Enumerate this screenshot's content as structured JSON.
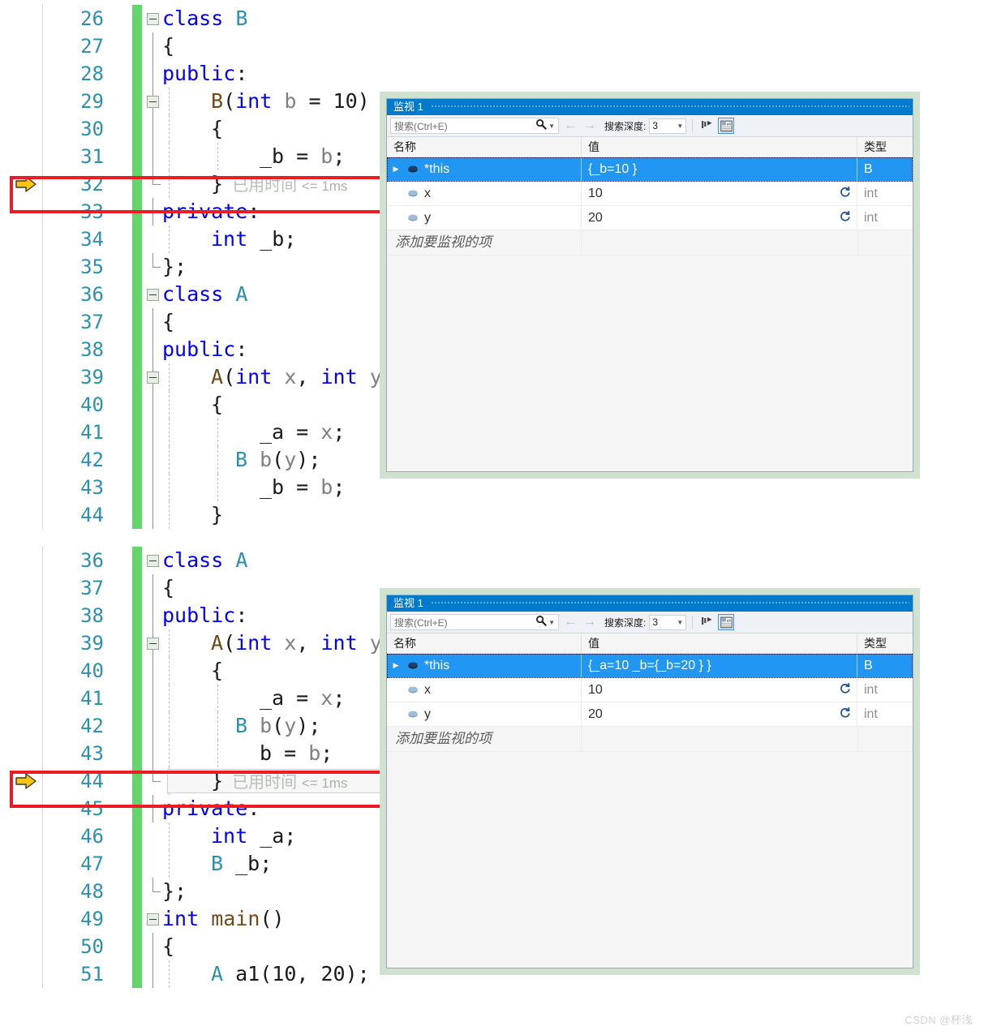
{
  "colors": {
    "accent_blue": "#007acc",
    "selection_blue": "#2196f3",
    "annotation_red": "#ed1c24",
    "change_bar_green": "#63d66b",
    "linenumber_teal": "#2b91af",
    "keyword_blue": "#0000ff",
    "type_teal": "#2b91af",
    "function_brown": "#6f4a18",
    "elapsed_gray": "#b6bfb6"
  },
  "editors": [
    {
      "name": "editor-top",
      "current_line": 32,
      "lines": [
        {
          "no": "26",
          "fold": "minus",
          "guide": "none",
          "tokens": [
            {
              "t": "class ",
              "c": "kw"
            },
            {
              "t": "B",
              "c": "typ"
            }
          ],
          "indent": 0
        },
        {
          "no": "27",
          "fold": null,
          "guide": "solid",
          "tokens": [
            {
              "t": "{",
              "c": "pun"
            }
          ],
          "indent": 0
        },
        {
          "no": "28",
          "fold": null,
          "guide": "solid",
          "tokens": [
            {
              "t": "public",
              "c": "kw"
            },
            {
              "t": ":",
              "c": "pun"
            }
          ],
          "indent": 0
        },
        {
          "no": "29",
          "fold": "minus",
          "guide": "solid-dash",
          "tokens": [
            {
              "t": "B",
              "c": "fn"
            },
            {
              "t": "(",
              "c": "pun"
            },
            {
              "t": "int",
              "c": "kw"
            },
            {
              "t": " b",
              "c": "var"
            },
            {
              "t": " = ",
              "c": "pun"
            },
            {
              "t": "10",
              "c": "num"
            },
            {
              "t": ")",
              "c": "pun"
            }
          ],
          "indent": 2
        },
        {
          "no": "30",
          "fold": null,
          "guide": "solid-dash",
          "tokens": [
            {
              "t": "{",
              "c": "pun"
            }
          ],
          "indent": 2
        },
        {
          "no": "31",
          "fold": null,
          "guide": "solid-dash2",
          "tokens": [
            {
              "t": "_b",
              "c": "idn"
            },
            {
              "t": " = ",
              "c": "pun"
            },
            {
              "t": "b",
              "c": "var"
            },
            {
              "t": ";",
              "c": "pun"
            }
          ],
          "indent": 4
        },
        {
          "no": "32",
          "fold": null,
          "guide": "solid-endcap-dash",
          "arrow": true,
          "tokens": [
            {
              "t": "}",
              "c": "pun"
            }
          ],
          "indent": 2,
          "elapsed": "已用时间",
          "elapsed_ms": "<= 1ms"
        },
        {
          "no": "33",
          "fold": null,
          "guide": "solid",
          "tokens": [
            {
              "t": "private",
              "c": "kw"
            },
            {
              "t": ":",
              "c": "pun"
            }
          ],
          "indent": 0
        },
        {
          "no": "34",
          "fold": null,
          "guide": "dash",
          "tokens": [
            {
              "t": "int",
              "c": "kw"
            },
            {
              "t": " _b;",
              "c": "idn"
            }
          ],
          "indent": 2
        },
        {
          "no": "35",
          "fold": null,
          "guide": "endcap",
          "tokens": [
            {
              "t": "};",
              "c": "pun"
            }
          ],
          "indent": 0
        },
        {
          "no": "36",
          "fold": "minus",
          "guide": "none",
          "tokens": [
            {
              "t": "class ",
              "c": "kw"
            },
            {
              "t": "A",
              "c": "typ"
            }
          ],
          "indent": 0
        },
        {
          "no": "37",
          "fold": null,
          "guide": "solid",
          "tokens": [
            {
              "t": "{",
              "c": "pun"
            }
          ],
          "indent": 0
        },
        {
          "no": "38",
          "fold": null,
          "guide": "solid",
          "tokens": [
            {
              "t": "public",
              "c": "kw"
            },
            {
              "t": ":",
              "c": "pun"
            }
          ],
          "indent": 0
        },
        {
          "no": "39",
          "fold": "minus",
          "guide": "solid-dash",
          "tokens": [
            {
              "t": "A",
              "c": "fn"
            },
            {
              "t": "(",
              "c": "pun"
            },
            {
              "t": "int",
              "c": "kw"
            },
            {
              "t": " x",
              "c": "var"
            },
            {
              "t": ", ",
              "c": "pun"
            },
            {
              "t": "int",
              "c": "kw"
            },
            {
              "t": " y",
              "c": "var"
            },
            {
              "t": ")",
              "c": "pun"
            }
          ],
          "indent": 2
        },
        {
          "no": "40",
          "fold": null,
          "guide": "solid-dash",
          "tokens": [
            {
              "t": "{",
              "c": "pun"
            }
          ],
          "indent": 2
        },
        {
          "no": "41",
          "fold": null,
          "guide": "solid-dash2",
          "tokens": [
            {
              "t": "_a",
              "c": "idn"
            },
            {
              "t": " = ",
              "c": "pun"
            },
            {
              "t": "x",
              "c": "var"
            },
            {
              "t": ";",
              "c": "pun"
            }
          ],
          "indent": 4
        },
        {
          "no": "42",
          "fold": null,
          "guide": "solid-dash2",
          "tokens": [
            {
              "t": "B",
              "c": "typ"
            },
            {
              "t": " b",
              "c": "var"
            },
            {
              "t": "(",
              "c": "pun"
            },
            {
              "t": "y",
              "c": "var"
            },
            {
              "t": ");",
              "c": "pun"
            }
          ],
          "indent": 3
        },
        {
          "no": "43",
          "fold": null,
          "guide": "solid-dash2",
          "tokens": [
            {
              "t": "_b",
              "c": "idn"
            },
            {
              "t": " = ",
              "c": "pun"
            },
            {
              "t": "b",
              "c": "var"
            },
            {
              "t": ";",
              "c": "pun"
            }
          ],
          "indent": 4
        },
        {
          "no": "44",
          "fold": null,
          "guide": "solid-dash",
          "tokens": [
            {
              "t": "}",
              "c": "pun"
            }
          ],
          "indent": 2
        }
      ]
    },
    {
      "name": "editor-bottom",
      "current_line": 44,
      "lines": [
        {
          "no": "36",
          "fold": "minus",
          "guide": "none",
          "tokens": [
            {
              "t": "class ",
              "c": "kw"
            },
            {
              "t": "A",
              "c": "typ"
            }
          ],
          "indent": 0
        },
        {
          "no": "37",
          "fold": null,
          "guide": "solid",
          "tokens": [
            {
              "t": "{",
              "c": "pun"
            }
          ],
          "indent": 0
        },
        {
          "no": "38",
          "fold": null,
          "guide": "solid",
          "tokens": [
            {
              "t": "public",
              "c": "kw"
            },
            {
              "t": ":",
              "c": "pun"
            }
          ],
          "indent": 0
        },
        {
          "no": "39",
          "fold": "minus",
          "guide": "solid-dash",
          "tokens": [
            {
              "t": "A",
              "c": "fn"
            },
            {
              "t": "(",
              "c": "pun"
            },
            {
              "t": "int",
              "c": "kw"
            },
            {
              "t": " x",
              "c": "var"
            },
            {
              "t": ", ",
              "c": "pun"
            },
            {
              "t": "int",
              "c": "kw"
            },
            {
              "t": " y",
              "c": "var"
            },
            {
              "t": ")",
              "c": "pun"
            }
          ],
          "indent": 2
        },
        {
          "no": "40",
          "fold": null,
          "guide": "solid-dash",
          "tokens": [
            {
              "t": "{",
              "c": "pun"
            }
          ],
          "indent": 2
        },
        {
          "no": "41",
          "fold": null,
          "guide": "solid-dash2",
          "tokens": [
            {
              "t": "_a",
              "c": "idn"
            },
            {
              "t": " = ",
              "c": "pun"
            },
            {
              "t": "x",
              "c": "var"
            },
            {
              "t": ";",
              "c": "pun"
            }
          ],
          "indent": 4
        },
        {
          "no": "42",
          "fold": null,
          "guide": "solid-dash2",
          "tokens": [
            {
              "t": "B",
              "c": "typ"
            },
            {
              "t": " b",
              "c": "var"
            },
            {
              "t": "(",
              "c": "pun"
            },
            {
              "t": "y",
              "c": "var"
            },
            {
              "t": ");",
              "c": "pun"
            }
          ],
          "indent": 3
        },
        {
          "no": "43",
          "fold": null,
          "guide": "solid-dash2",
          "tokens": [
            {
              "t": "b",
              "c": "idn"
            },
            {
              "t": " = ",
              "c": "pun"
            },
            {
              "t": "b",
              "c": "var"
            },
            {
              "t": ";",
              "c": "pun"
            }
          ],
          "indent": 4
        },
        {
          "no": "44",
          "fold": null,
          "guide": "solid-endcap-dash",
          "arrow": true,
          "current": true,
          "tokens": [
            {
              "t": "}",
              "c": "pun"
            }
          ],
          "indent": 2,
          "elapsed": "已用时间",
          "elapsed_ms": "<= 1ms"
        },
        {
          "no": "45",
          "fold": null,
          "guide": "solid",
          "tokens": [
            {
              "t": "private",
              "c": "kw"
            },
            {
              "t": ":",
              "c": "pun"
            }
          ],
          "indent": 0
        },
        {
          "no": "46",
          "fold": null,
          "guide": "dash",
          "tokens": [
            {
              "t": "int",
              "c": "kw"
            },
            {
              "t": " _a;",
              "c": "idn"
            }
          ],
          "indent": 2
        },
        {
          "no": "47",
          "fold": null,
          "guide": "dash",
          "tokens": [
            {
              "t": "B",
              "c": "typ"
            },
            {
              "t": " _b;",
              "c": "idn"
            }
          ],
          "indent": 2
        },
        {
          "no": "48",
          "fold": null,
          "guide": "endcap",
          "tokens": [
            {
              "t": "};",
              "c": "pun"
            }
          ],
          "indent": 0
        },
        {
          "no": "49",
          "fold": "minus",
          "guide": "none",
          "tokens": [
            {
              "t": "int",
              "c": "kw"
            },
            {
              "t": " ",
              "c": "pun"
            },
            {
              "t": "main",
              "c": "fn"
            },
            {
              "t": "()",
              "c": "pun"
            }
          ],
          "indent": 0
        },
        {
          "no": "50",
          "fold": null,
          "guide": "solid",
          "tokens": [
            {
              "t": "{",
              "c": "pun"
            }
          ],
          "indent": 0
        },
        {
          "no": "51",
          "fold": null,
          "guide": "solid-dash",
          "tokens": [
            {
              "t": "A",
              "c": "typ"
            },
            {
              "t": " a1",
              "c": "idn"
            },
            {
              "t": "(",
              "c": "pun"
            },
            {
              "t": "10",
              "c": "num"
            },
            {
              "t": ", ",
              "c": "pun"
            },
            {
              "t": "20",
              "c": "num"
            },
            {
              "t": ");",
              "c": "pun"
            }
          ],
          "indent": 2
        }
      ]
    }
  ],
  "watch_windows": [
    {
      "name": "watch-window-top",
      "title": "监视 1",
      "search": {
        "placeholder": "搜索(Ctrl+E)",
        "value": ""
      },
      "depth_label": "搜索深度:",
      "depth_value": "3",
      "columns": {
        "name": "名称",
        "value": "值",
        "type": "类型"
      },
      "rows": [
        {
          "name": "*this",
          "value": "{_b=10 }",
          "type": "B",
          "selected": true,
          "expandable": true,
          "refresh": false
        },
        {
          "name": "x",
          "value": "10",
          "type": "int",
          "selected": false,
          "expandable": false,
          "refresh": true
        },
        {
          "name": "y",
          "value": "20",
          "type": "int",
          "selected": false,
          "expandable": false,
          "refresh": true
        }
      ],
      "add_watch_text": "添加要监视的项"
    },
    {
      "name": "watch-window-bottom",
      "title": "监视 1",
      "search": {
        "placeholder": "搜索(Ctrl+E)",
        "value": ""
      },
      "depth_label": "搜索深度:",
      "depth_value": "3",
      "columns": {
        "name": "名称",
        "value": "值",
        "type": "类型"
      },
      "rows": [
        {
          "name": "*this",
          "value": "{_a=10 _b={_b=20 } }",
          "type": "B",
          "selected": true,
          "expandable": true,
          "refresh": false
        },
        {
          "name": "x",
          "value": "10",
          "type": "int",
          "selected": false,
          "expandable": false,
          "refresh": true
        },
        {
          "name": "y",
          "value": "20",
          "type": "int",
          "selected": false,
          "expandable": false,
          "refresh": true
        }
      ],
      "add_watch_text": "添加要监视的项"
    }
  ],
  "watermark": "CSDN @杯浅"
}
